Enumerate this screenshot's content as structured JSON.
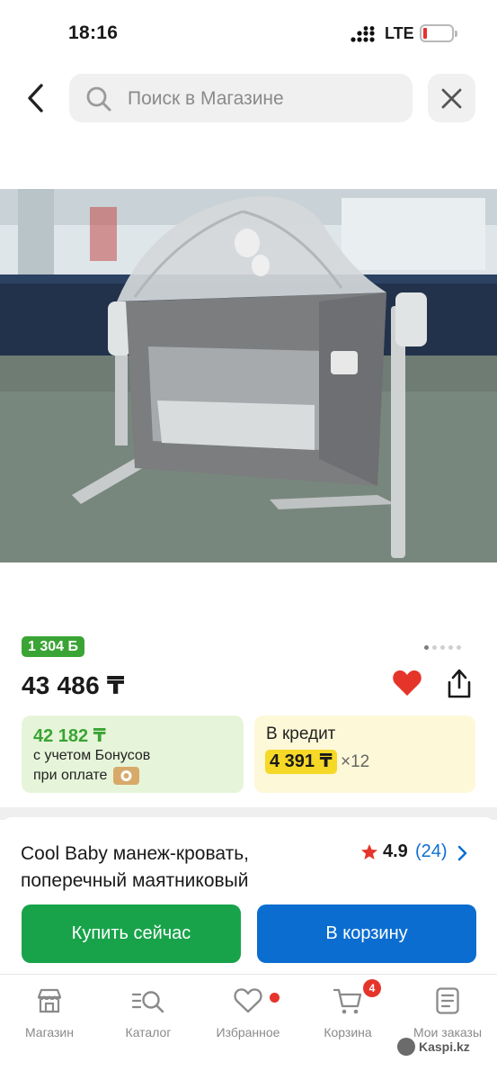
{
  "status": {
    "time": "18:16",
    "network": "LTE",
    "signal_icon": "signal-bars-icon",
    "battery_icon": "battery-low-icon",
    "battery_color": "#e8312f"
  },
  "search": {
    "placeholder": "Поиск в Магазине",
    "back_icon": "chevron-left-icon",
    "clear_icon": "close-icon"
  },
  "gallery": {
    "image": "baby-crib-photo",
    "page": 1,
    "total": 5
  },
  "product": {
    "bonus": "1 304 Б",
    "price": "43 486 ₸",
    "title": "Cool Baby манеж-кровать, поперечный маятниковый",
    "rating": "4.9",
    "reviews": "(24)"
  },
  "bonus_card": {
    "price": "42 182 ₸",
    "line1": "с учетом Бонусов",
    "line2": "при оплате"
  },
  "credit_card": {
    "label": "В кредит",
    "monthly": "4 391 ₸",
    "multiplier": "×12"
  },
  "actions": {
    "buy": "Купить сейчас",
    "cart": "В корзину"
  },
  "tabs": [
    {
      "label": "Магазин",
      "icon": "shop-icon"
    },
    {
      "label": "Каталог",
      "icon": "catalog-search-icon"
    },
    {
      "label": "Избранное",
      "icon": "heart-icon"
    },
    {
      "label": "Корзина",
      "icon": "cart-icon",
      "badge": "4"
    },
    {
      "label": "Мои заказы",
      "icon": "orders-icon"
    }
  ],
  "watermark": "Kaspi.kz",
  "colors": {
    "green": "#18a34a",
    "blue": "#0b6dd0",
    "bonus_green": "#3aa434",
    "credit_yellow": "#f6d827",
    "heart_red": "#e5352b"
  }
}
